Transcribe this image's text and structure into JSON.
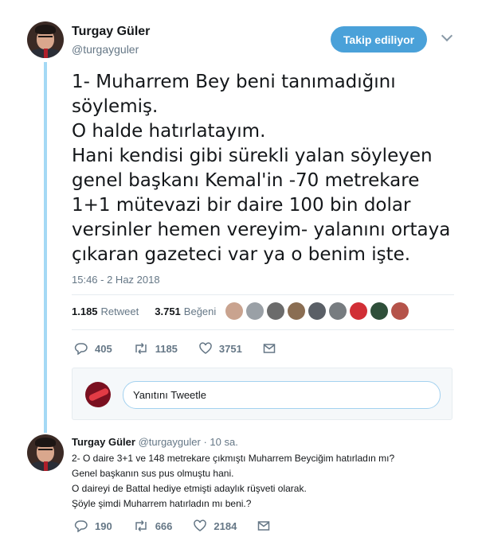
{
  "tweet": {
    "author_name": "Turgay Güler",
    "author_handle": "@turgayguler",
    "follow_label": "Takip ediliyor",
    "text_lines": [
      "1- Muharrem Bey beni tanımadığını",
      "söylemiş.",
      "O halde hatırlatayım.",
      "Hani kendisi gibi sürekli yalan söyleyen",
      "genel başkanı Kemal'in -70 metrekare",
      "1+1 mütevazi bir daire 100 bin dolar",
      "versinler hemen vereyim- yalanını ortaya",
      "çıkaran gazeteci var ya o benim işte."
    ],
    "timestamp": "15:46 - 2 Haz 2018",
    "retweet_count": "1.185",
    "retweet_label": "Retweet",
    "like_count": "3.751",
    "like_label": "Beğeni",
    "liker_colors": [
      "#c9a38f",
      "#9aa0a6",
      "#6b6b6b",
      "#8a6d52",
      "#5a5f66",
      "#777c80",
      "#d12f36",
      "#2f4f3a",
      "#b5534a"
    ],
    "actions": {
      "reply": "405",
      "retweet": "1185",
      "like": "3751"
    }
  },
  "reply_box": {
    "placeholder": "Yanıtını Tweetle"
  },
  "reply": {
    "author_name": "Turgay Güler",
    "author_handle": "@turgayguler",
    "time": "· 10 sa.",
    "text_lines": [
      "2- O daire 3+1 ve 148 metrekare çıkmıştı Muharrem Beyciğim hatırladın mı?",
      "Genel başkanın sus pus olmuştu hani.",
      "O daireyi de Battal hediye etmişti adaylık rüşveti olarak.",
      "Şöyle şimdi Muharrem hatırladın mı beni.?"
    ],
    "actions": {
      "reply": "190",
      "retweet": "666",
      "like": "2184"
    }
  },
  "colors": {
    "accent": "#4aa1d9",
    "thread_line": "#a4d9f5",
    "muted": "#657786"
  }
}
